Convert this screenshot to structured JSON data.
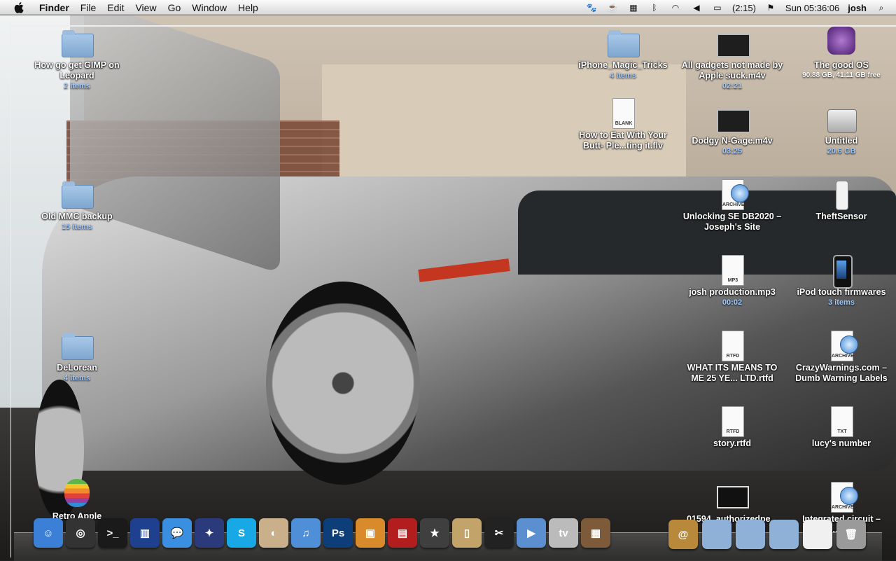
{
  "menubar": {
    "apple_icon": "apple-icon",
    "app_name": "Finder",
    "menus": [
      "File",
      "Edit",
      "View",
      "Go",
      "Window",
      "Help"
    ],
    "battery": "(2:15)",
    "clock": "Sun 05:36:06",
    "user": "josh",
    "extras": [
      "growl-paw-icon",
      "coffee-cup-icon",
      "spaces-icon",
      "bluetooth-icon",
      "wifi-icon",
      "volume-icon",
      "battery-icon",
      "uk-flag-icon",
      "spotlight-icon"
    ]
  },
  "desktop_icons": {
    "gimp": {
      "name": "How go get GIMP on Leopard",
      "sub": "2 items"
    },
    "mmc": {
      "name": "Old MMC backup",
      "sub": "15 items"
    },
    "delorean": {
      "name": "DeLorean",
      "sub": "4 items"
    },
    "retro": {
      "name": "Retro Apple"
    },
    "iphone_tricks": {
      "name": "iPhone_Magic_Tricks",
      "sub": "4 items"
    },
    "eat_butt": {
      "name": "How to Eat With Your Butt- Ple...ting it.flv",
      "doc": "BLANK"
    },
    "gadgets": {
      "name": "All gadgets not made by Apple suck.m4v",
      "sub": "02:21"
    },
    "ngage": {
      "name": "Dodgy N-Gage.m4v",
      "sub": "03:25"
    },
    "unlocking": {
      "name": "Unlocking SE DB2020 – Joseph's Site",
      "doc": "ARCHIVE"
    },
    "josh_mp3": {
      "name": "josh production.mp3",
      "sub": "00:02",
      "doc": "MP3"
    },
    "what_its_means": {
      "name": "WHAT ITS MEANS TO ME 25 YE... LTD.rtfd",
      "doc": "RTFD"
    },
    "story": {
      "name": "story.rtfd",
      "doc": "RTFD"
    },
    "authorized": {
      "name": "01594_authorizedpe..."
    },
    "good_os": {
      "name": "The good OS",
      "sub": "90.88 GB, 41.11 GB free"
    },
    "untitled": {
      "name": "Untitled",
      "sub": "20.6 GB"
    },
    "theft": {
      "name": "TheftSensor"
    },
    "ipod_fw": {
      "name": "iPod touch firmwares",
      "sub": "3 items"
    },
    "crazy": {
      "name": "CrazyWarnings.com – Dumb Warning Labels",
      "doc": "ARCHIVE"
    },
    "lucy": {
      "name": "lucy's number",
      "doc": "TXT"
    },
    "integrated": {
      "name": "Integrated circuit – W...pedia",
      "doc": "ARCHIVE"
    }
  },
  "dock": {
    "apps": [
      {
        "icon": "finder-icon",
        "color": "#3b7fd6",
        "glyph": "☺"
      },
      {
        "icon": "dashboard-icon",
        "color": "#333333",
        "glyph": "◎"
      },
      {
        "icon": "terminal-icon",
        "color": "#1a1a1a",
        "glyph": ">_"
      },
      {
        "icon": "tardis-icon",
        "color": "#1f3f8f",
        "glyph": "▥"
      },
      {
        "icon": "ichat-icon",
        "color": "#3a8fe0",
        "glyph": "💬"
      },
      {
        "icon": "wizard-icon",
        "color": "#2a3a7a",
        "glyph": "✦"
      },
      {
        "icon": "skype-icon",
        "color": "#19a8e6",
        "glyph": "S"
      },
      {
        "icon": "preview-icon",
        "color": "#c9b08a",
        "glyph": "◐"
      },
      {
        "icon": "itunes-icon",
        "color": "#4f8fd8",
        "glyph": "♫"
      },
      {
        "icon": "photoshop-icon",
        "color": "#0d3e7a",
        "glyph": "Ps"
      },
      {
        "icon": "iphoto-icon",
        "color": "#d98b2b",
        "glyph": "▣"
      },
      {
        "icon": "photo-booth-icon",
        "color": "#b21d1d",
        "glyph": "▤"
      },
      {
        "icon": "imovie-icon",
        "color": "#3f3f3f",
        "glyph": "★"
      },
      {
        "icon": "safe-icon",
        "color": "#c2a46a",
        "glyph": "▯"
      },
      {
        "icon": "final-cut-icon",
        "color": "#222222",
        "glyph": "✂"
      },
      {
        "icon": "quicktime-icon",
        "color": "#5c8fd0",
        "glyph": "▶"
      },
      {
        "icon": "apple-tv-icon",
        "color": "#bbbbbb",
        "glyph": "tv"
      },
      {
        "icon": "gift-box-icon",
        "color": "#7d5a3a",
        "glyph": "▦"
      }
    ],
    "right": [
      {
        "icon": "address-book-icon",
        "color": "#b8893a",
        "glyph": "@"
      },
      {
        "icon": "applications-folder-icon",
        "color": "#8fb1d8",
        "glyph": ""
      },
      {
        "icon": "documents-folder-icon",
        "color": "#8fb1d8",
        "glyph": ""
      },
      {
        "icon": "downloads-folder-icon",
        "color": "#8fb1d8",
        "glyph": ""
      },
      {
        "icon": "blank-document-icon",
        "color": "#f0f0f0",
        "glyph": ""
      },
      {
        "icon": "trash-icon",
        "color": "#9a9a9a",
        "glyph": "🗑"
      }
    ]
  }
}
